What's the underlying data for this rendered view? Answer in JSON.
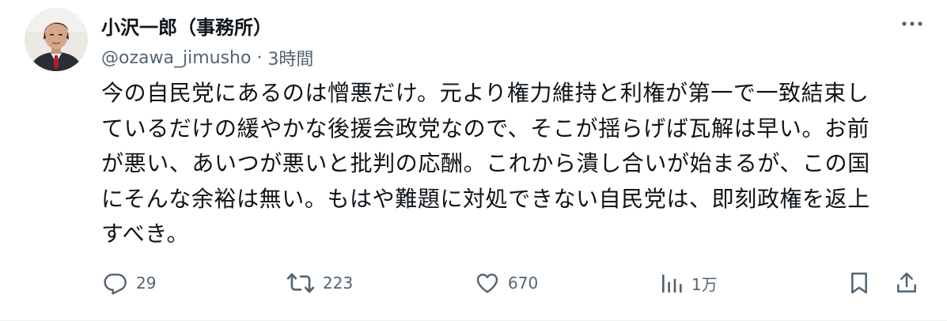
{
  "author": {
    "display_name": "小沢一郎（事務所）",
    "handle": "@ozawa_jimusho",
    "separator": "·",
    "timestamp": "3時間"
  },
  "tweet": {
    "lines": [
      "今の自民党にあるのは憎悪だけ。元より権力維持と利権が第一で一致結束し",
      "ているだけの緩やかな後援会政党なので、そこが揺らげば瓦解は早い。お前",
      "が悪い、あいつが悪いと批判の応酬。これから潰し合いが始まるが、この国",
      "にそんな余裕は無い。もはや難題に対処できない自民党は、即刻政権を返上",
      "すべき。"
    ]
  },
  "actions": {
    "reply": {
      "icon": "reply-icon",
      "count": "29"
    },
    "retweet": {
      "icon": "retweet-icon",
      "count": "223"
    },
    "like": {
      "icon": "heart-icon",
      "count": "670"
    },
    "views": {
      "icon": "views-icon",
      "count": "1万"
    },
    "bookmark": {
      "icon": "bookmark-icon"
    },
    "share": {
      "icon": "share-icon"
    }
  },
  "colors": {
    "text": "#0f1419",
    "secondary": "#536471",
    "divider": "#eff3f4"
  }
}
